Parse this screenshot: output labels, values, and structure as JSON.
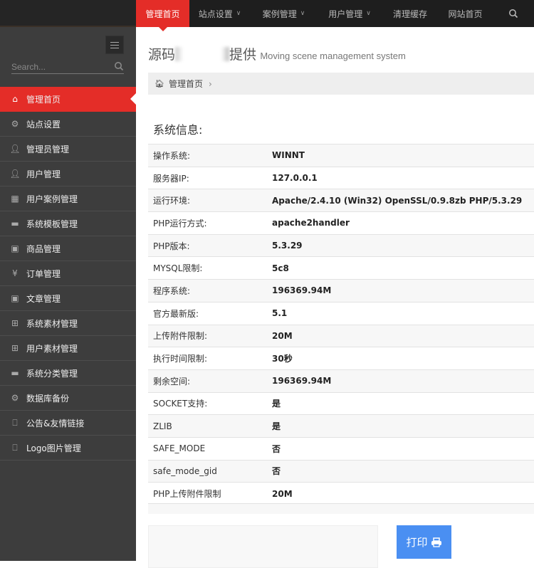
{
  "sidebar": {
    "search_placeholder": "Search...",
    "items": [
      {
        "label": "管理首页",
        "icon": "home-icon",
        "active": true
      },
      {
        "label": "站点设置",
        "icon": "cogs-icon"
      },
      {
        "label": "管理员管理",
        "icon": "user-icon"
      },
      {
        "label": "用户管理",
        "icon": "user-icon"
      },
      {
        "label": "用户案例管理",
        "icon": "table-icon"
      },
      {
        "label": "系统模板管理",
        "icon": "briefcase-icon"
      },
      {
        "label": "商品管理",
        "icon": "caret-square-icon"
      },
      {
        "label": "订单管理",
        "icon": "yen-icon"
      },
      {
        "label": "文章管理",
        "icon": "caret-square-icon"
      },
      {
        "label": "系统素材管理",
        "icon": "gift-icon"
      },
      {
        "label": "用户素材管理",
        "icon": "gift-icon"
      },
      {
        "label": "系统分类管理",
        "icon": "briefcase-icon"
      },
      {
        "label": "数据库备份",
        "icon": "cogs-icon"
      },
      {
        "label": "公告&友情链接",
        "icon": "bookmark-icon"
      },
      {
        "label": "Logo图片管理",
        "icon": "bookmark-icon"
      }
    ]
  },
  "topnav": {
    "items": [
      {
        "label": "管理首页",
        "active": true,
        "dropdown": false
      },
      {
        "label": "站点设置",
        "dropdown": true
      },
      {
        "label": "案例管理",
        "dropdown": true
      },
      {
        "label": "用户管理",
        "dropdown": true
      },
      {
        "label": "清理缓存",
        "dropdown": false
      },
      {
        "label": "网站首页",
        "dropdown": false
      }
    ],
    "search_icon": "search-icon"
  },
  "header": {
    "title_prefix": "源码",
    "title_suffix": "提供",
    "subtitle": "Moving scene management system"
  },
  "breadcrumb": {
    "items": [
      "管理首页"
    ]
  },
  "system_info": {
    "title": "系统信息:",
    "rows": [
      {
        "key": "操作系统:",
        "value": "WINNT"
      },
      {
        "key": "服务器IP:",
        "value": "127.0.0.1"
      },
      {
        "key": "运行环境:",
        "value": "Apache/2.4.10 (Win32) OpenSSL/0.9.8zb PHP/5.3.29"
      },
      {
        "key": "PHP运行方式:",
        "value": "apache2handler"
      },
      {
        "key": "PHP版本:",
        "value": "5.3.29"
      },
      {
        "key": "MYSQL限制:",
        "value": "5c8"
      },
      {
        "key": "程序系统:",
        "value": "196369.94M"
      },
      {
        "key": "官方最新版:",
        "value": "5.1"
      },
      {
        "key": "上传附件限制:",
        "value": "20M"
      },
      {
        "key": "执行时间限制:",
        "value": "30秒"
      },
      {
        "key": "剩余空间:",
        "value": "196369.94M"
      },
      {
        "key": "SOCKET支持:",
        "value": "是"
      },
      {
        "key": "ZLIB",
        "value": "是"
      },
      {
        "key": "SAFE_MODE",
        "value": "否"
      },
      {
        "key": "safe_mode_gid",
        "value": "否"
      },
      {
        "key": "PHP上传附件限制",
        "value": "20M"
      }
    ]
  },
  "actions": {
    "print_label": "打印"
  },
  "colors": {
    "accent": "#e42d28",
    "sidebar_bg": "#3d3d3d",
    "topnav_bg": "#1e1e1e",
    "print_button": "#4a8ff2"
  }
}
